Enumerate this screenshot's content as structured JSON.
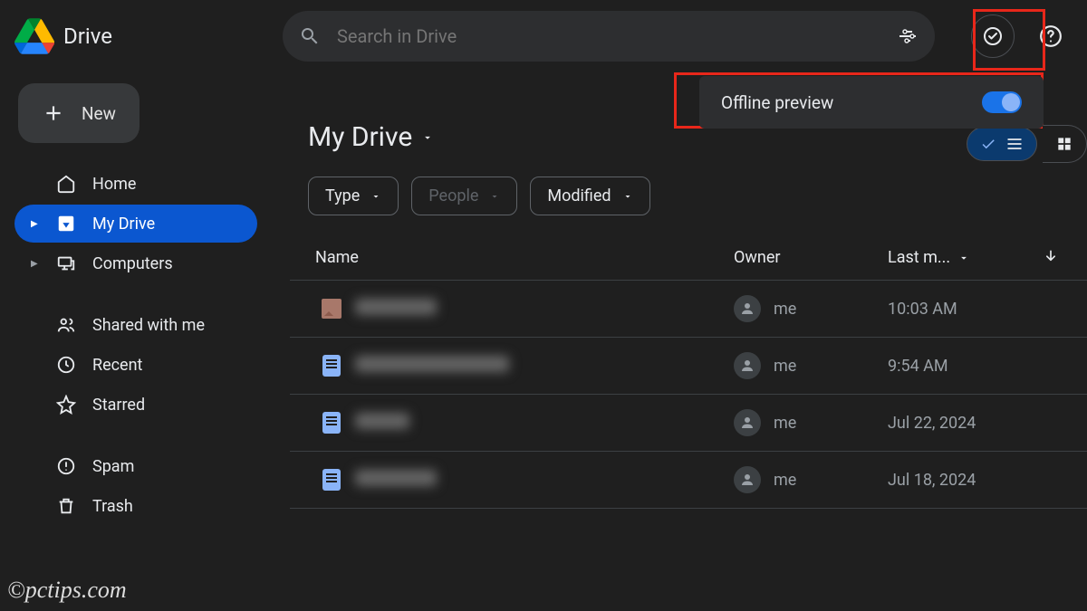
{
  "app": {
    "title": "Drive"
  },
  "search": {
    "placeholder": "Search in Drive"
  },
  "sidebar": {
    "new_label": "New",
    "items": [
      {
        "label": "Home"
      },
      {
        "label": "My Drive"
      },
      {
        "label": "Computers"
      }
    ],
    "items2": [
      {
        "label": "Shared with me"
      },
      {
        "label": "Recent"
      },
      {
        "label": "Starred"
      }
    ],
    "items3": [
      {
        "label": "Spam"
      },
      {
        "label": "Trash"
      }
    ]
  },
  "offline": {
    "label": "Offline preview",
    "enabled": true
  },
  "main": {
    "title": "My Drive",
    "filters": [
      {
        "label": "Type"
      },
      {
        "label": "People"
      },
      {
        "label": "Modified"
      }
    ],
    "columns": {
      "name": "Name",
      "owner": "Owner",
      "modified": "Last m..."
    },
    "rows": [
      {
        "type": "image",
        "owner": "me",
        "modified": "10:03 AM",
        "name_width": 90
      },
      {
        "type": "doc",
        "owner": "me",
        "modified": "9:54 AM",
        "name_width": 170
      },
      {
        "type": "doc",
        "owner": "me",
        "modified": "Jul 22, 2024",
        "name_width": 60
      },
      {
        "type": "doc",
        "owner": "me",
        "modified": "Jul 18, 2024",
        "name_width": 90
      }
    ]
  },
  "watermark": "©pctips.com"
}
